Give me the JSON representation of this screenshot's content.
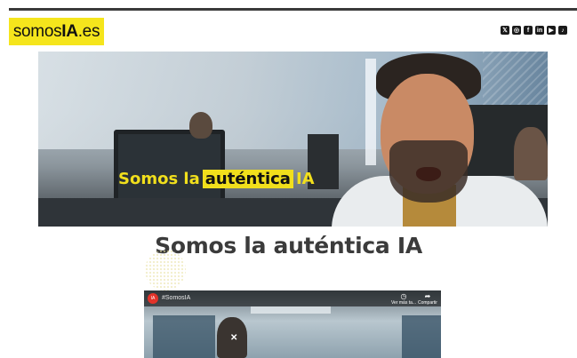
{
  "header": {
    "logo": {
      "prefix": "somos",
      "strong": "IA",
      "suffix": ".es"
    },
    "colors": {
      "brand_yellow": "#f5e51c"
    },
    "socials": [
      {
        "name": "x-icon",
        "glyph": "𝕏"
      },
      {
        "name": "instagram-icon",
        "glyph": "◎"
      },
      {
        "name": "facebook-icon",
        "glyph": "f"
      },
      {
        "name": "linkedin-icon",
        "glyph": "in"
      },
      {
        "name": "youtube-icon",
        "glyph": "▶"
      },
      {
        "name": "tiktok-icon",
        "glyph": "♪"
      }
    ]
  },
  "hero": {
    "overlay_before": "Somos la",
    "overlay_highlight": "auténtica",
    "overlay_after": "IA"
  },
  "main": {
    "title": "Somos la auténtica IA"
  },
  "video": {
    "channel_logo": "IA",
    "title": "#SomosIA",
    "watch_later_label": "Ver más ta...",
    "share_label": "Compartir",
    "watch_later_icon": "clock-icon",
    "share_icon": "share-icon"
  }
}
